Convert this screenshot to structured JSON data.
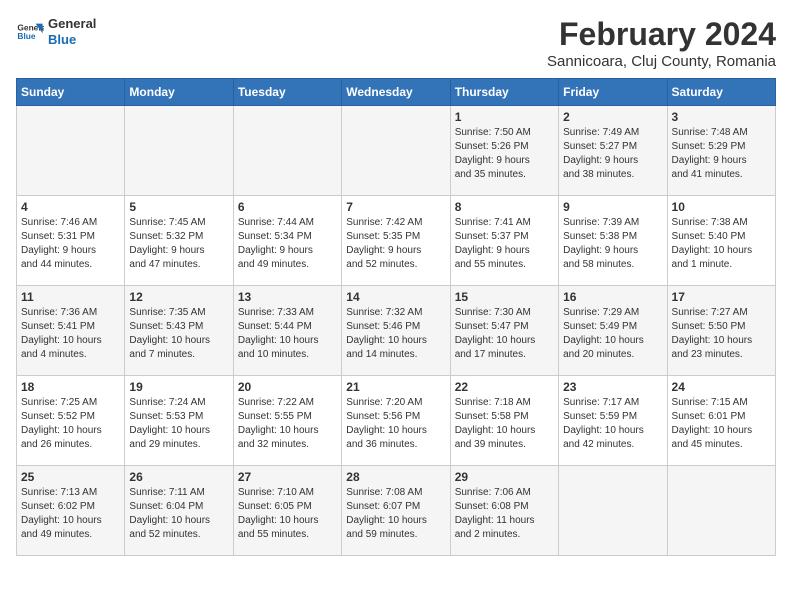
{
  "header": {
    "logo_line1": "General",
    "logo_line2": "Blue",
    "main_title": "February 2024",
    "subtitle": "Sannicoara, Cluj County, Romania"
  },
  "calendar": {
    "days_of_week": [
      "Sunday",
      "Monday",
      "Tuesday",
      "Wednesday",
      "Thursday",
      "Friday",
      "Saturday"
    ],
    "weeks": [
      [
        {
          "day": "",
          "info": ""
        },
        {
          "day": "",
          "info": ""
        },
        {
          "day": "",
          "info": ""
        },
        {
          "day": "",
          "info": ""
        },
        {
          "day": "1",
          "info": "Sunrise: 7:50 AM\nSunset: 5:26 PM\nDaylight: 9 hours\nand 35 minutes."
        },
        {
          "day": "2",
          "info": "Sunrise: 7:49 AM\nSunset: 5:27 PM\nDaylight: 9 hours\nand 38 minutes."
        },
        {
          "day": "3",
          "info": "Sunrise: 7:48 AM\nSunset: 5:29 PM\nDaylight: 9 hours\nand 41 minutes."
        }
      ],
      [
        {
          "day": "4",
          "info": "Sunrise: 7:46 AM\nSunset: 5:31 PM\nDaylight: 9 hours\nand 44 minutes."
        },
        {
          "day": "5",
          "info": "Sunrise: 7:45 AM\nSunset: 5:32 PM\nDaylight: 9 hours\nand 47 minutes."
        },
        {
          "day": "6",
          "info": "Sunrise: 7:44 AM\nSunset: 5:34 PM\nDaylight: 9 hours\nand 49 minutes."
        },
        {
          "day": "7",
          "info": "Sunrise: 7:42 AM\nSunset: 5:35 PM\nDaylight: 9 hours\nand 52 minutes."
        },
        {
          "day": "8",
          "info": "Sunrise: 7:41 AM\nSunset: 5:37 PM\nDaylight: 9 hours\nand 55 minutes."
        },
        {
          "day": "9",
          "info": "Sunrise: 7:39 AM\nSunset: 5:38 PM\nDaylight: 9 hours\nand 58 minutes."
        },
        {
          "day": "10",
          "info": "Sunrise: 7:38 AM\nSunset: 5:40 PM\nDaylight: 10 hours\nand 1 minute."
        }
      ],
      [
        {
          "day": "11",
          "info": "Sunrise: 7:36 AM\nSunset: 5:41 PM\nDaylight: 10 hours\nand 4 minutes."
        },
        {
          "day": "12",
          "info": "Sunrise: 7:35 AM\nSunset: 5:43 PM\nDaylight: 10 hours\nand 7 minutes."
        },
        {
          "day": "13",
          "info": "Sunrise: 7:33 AM\nSunset: 5:44 PM\nDaylight: 10 hours\nand 10 minutes."
        },
        {
          "day": "14",
          "info": "Sunrise: 7:32 AM\nSunset: 5:46 PM\nDaylight: 10 hours\nand 14 minutes."
        },
        {
          "day": "15",
          "info": "Sunrise: 7:30 AM\nSunset: 5:47 PM\nDaylight: 10 hours\nand 17 minutes."
        },
        {
          "day": "16",
          "info": "Sunrise: 7:29 AM\nSunset: 5:49 PM\nDaylight: 10 hours\nand 20 minutes."
        },
        {
          "day": "17",
          "info": "Sunrise: 7:27 AM\nSunset: 5:50 PM\nDaylight: 10 hours\nand 23 minutes."
        }
      ],
      [
        {
          "day": "18",
          "info": "Sunrise: 7:25 AM\nSunset: 5:52 PM\nDaylight: 10 hours\nand 26 minutes."
        },
        {
          "day": "19",
          "info": "Sunrise: 7:24 AM\nSunset: 5:53 PM\nDaylight: 10 hours\nand 29 minutes."
        },
        {
          "day": "20",
          "info": "Sunrise: 7:22 AM\nSunset: 5:55 PM\nDaylight: 10 hours\nand 32 minutes."
        },
        {
          "day": "21",
          "info": "Sunrise: 7:20 AM\nSunset: 5:56 PM\nDaylight: 10 hours\nand 36 minutes."
        },
        {
          "day": "22",
          "info": "Sunrise: 7:18 AM\nSunset: 5:58 PM\nDaylight: 10 hours\nand 39 minutes."
        },
        {
          "day": "23",
          "info": "Sunrise: 7:17 AM\nSunset: 5:59 PM\nDaylight: 10 hours\nand 42 minutes."
        },
        {
          "day": "24",
          "info": "Sunrise: 7:15 AM\nSunset: 6:01 PM\nDaylight: 10 hours\nand 45 minutes."
        }
      ],
      [
        {
          "day": "25",
          "info": "Sunrise: 7:13 AM\nSunset: 6:02 PM\nDaylight: 10 hours\nand 49 minutes."
        },
        {
          "day": "26",
          "info": "Sunrise: 7:11 AM\nSunset: 6:04 PM\nDaylight: 10 hours\nand 52 minutes."
        },
        {
          "day": "27",
          "info": "Sunrise: 7:10 AM\nSunset: 6:05 PM\nDaylight: 10 hours\nand 55 minutes."
        },
        {
          "day": "28",
          "info": "Sunrise: 7:08 AM\nSunset: 6:07 PM\nDaylight: 10 hours\nand 59 minutes."
        },
        {
          "day": "29",
          "info": "Sunrise: 7:06 AM\nSunset: 6:08 PM\nDaylight: 11 hours\nand 2 minutes."
        },
        {
          "day": "",
          "info": ""
        },
        {
          "day": "",
          "info": ""
        }
      ]
    ]
  }
}
